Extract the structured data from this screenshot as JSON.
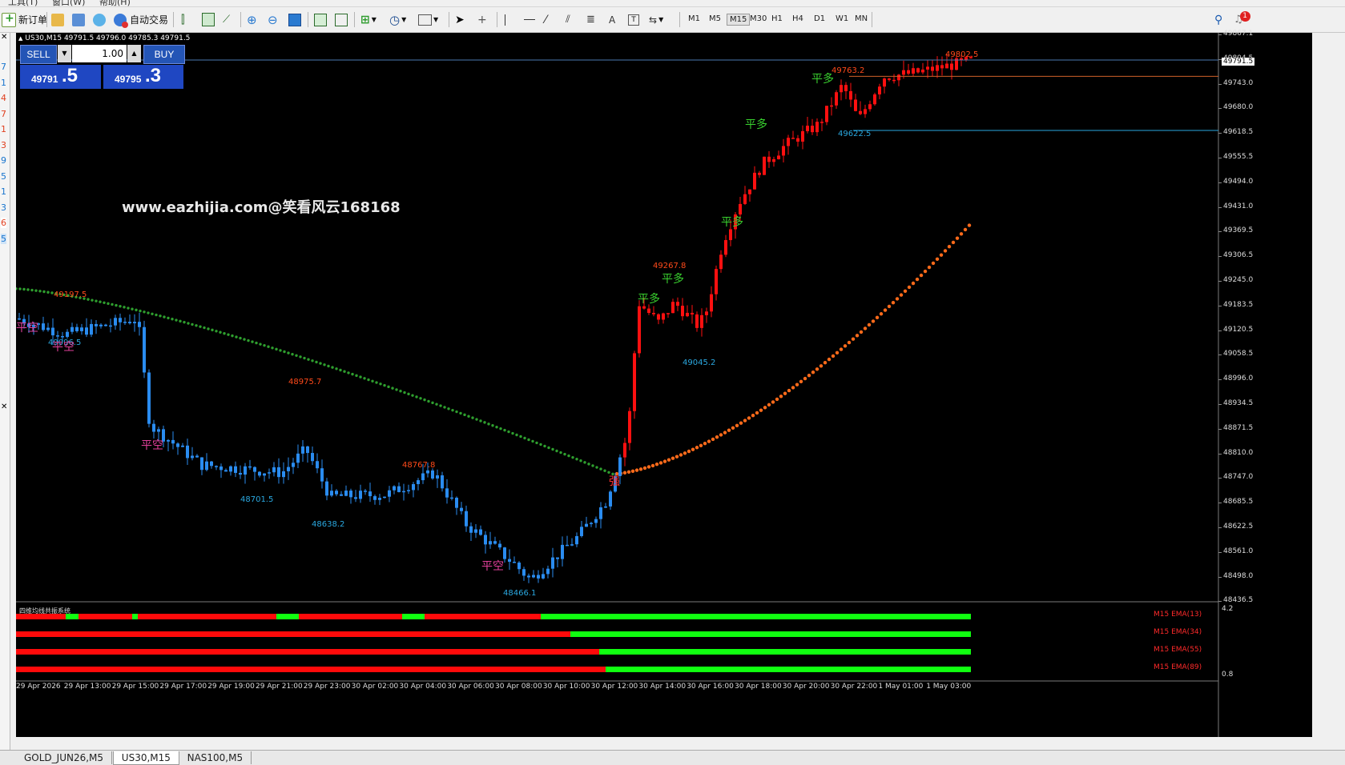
{
  "menu": {
    "tools": "工具(T)",
    "window": "窗口(W)",
    "help": "帮助(H)"
  },
  "toolbar": {
    "new_order": "新订单",
    "auto_trade": "自动交易",
    "timeframes": [
      "M1",
      "M5",
      "M15",
      "M30",
      "H1",
      "H4",
      "D1",
      "W1",
      "MN"
    ],
    "active_timeframe": "M15",
    "alert_count": "1"
  },
  "left_strip_digits": [
    "7",
    "1",
    "4",
    "7",
    "1",
    "3",
    "9",
    "5",
    "1",
    "3",
    "6",
    "5"
  ],
  "chart": {
    "header": "US30,M15  49791.5 49796.0 49785.3 49791.5",
    "watermark": "www.eazhijia.com@笑看风云168168",
    "trade": {
      "sell_label": "SELL",
      "buy_label": "BUY",
      "volume": "1.00",
      "sell_big": "49791",
      "sell_small": ".5",
      "buy_big": "49795",
      "buy_small": ".3"
    },
    "price_axis": [
      "49867.1",
      "49804.5",
      "49743.0",
      "49680.0",
      "49618.5",
      "49555.5",
      "49494.0",
      "49431.0",
      "49369.5",
      "49306.5",
      "49245.0",
      "49183.5",
      "49120.5",
      "49058.5",
      "48996.0",
      "48934.5",
      "48871.5",
      "48810.0",
      "48747.0",
      "48685.5",
      "48622.5",
      "48561.0",
      "48498.0",
      "48436.5"
    ],
    "current_price_tag": "49791.5",
    "time_axis": [
      "29 Apr 2026",
      "29 Apr 13:00",
      "29 Apr 15:00",
      "29 Apr 17:00",
      "29 Apr 19:00",
      "29 Apr 21:00",
      "29 Apr 23:00",
      "30 Apr 02:00",
      "30 Apr 04:00",
      "30 Apr 06:00",
      "30 Apr 08:00",
      "30 Apr 10:00",
      "30 Apr 12:00",
      "30 Apr 14:00",
      "30 Apr 16:00",
      "30 Apr 18:00",
      "30 Apr 20:00",
      "30 Apr 22:00",
      "1 May 01:00",
      "1 May 03:00"
    ],
    "price_labels": [
      {
        "text": "49197.5",
        "kind": "high"
      },
      {
        "text": "49096.5",
        "kind": "low"
      },
      {
        "text": "48975.7",
        "kind": "high"
      },
      {
        "text": "48701.5",
        "kind": "low"
      },
      {
        "text": "48638.2",
        "kind": "low"
      },
      {
        "text": "48767.8",
        "kind": "high"
      },
      {
        "text": "48466.1",
        "kind": "low"
      },
      {
        "text": "49267.8",
        "kind": "high"
      },
      {
        "text": "49045.2",
        "kind": "low"
      },
      {
        "text": "49763.2",
        "kind": "high"
      },
      {
        "text": "49622.5",
        "kind": "low"
      },
      {
        "text": "49802.5",
        "kind": "high"
      }
    ],
    "signals": [
      {
        "text": "平空",
        "color": "#e0409a"
      },
      {
        "text": "平空",
        "color": "#e0409a"
      },
      {
        "text": "平空",
        "color": "#e0409a"
      },
      {
        "text": "平空",
        "color": "#e0409a"
      },
      {
        "text": "强",
        "color": "#ff3030"
      },
      {
        "text": "平多",
        "color": "#39d12f"
      },
      {
        "text": "平多",
        "color": "#39d12f"
      },
      {
        "text": "平多",
        "color": "#39d12f"
      },
      {
        "text": "平多",
        "color": "#39d12f"
      },
      {
        "text": "平多",
        "color": "#39d12f"
      }
    ],
    "indicator_title": "四维均线共振系统",
    "indicator_scale": [
      "4.2",
      "0.8"
    ],
    "ema_labels": [
      "M15 EMA(13)",
      "M15 EMA(34)",
      "M15 EMA(55)",
      "M15 EMA(89)"
    ]
  },
  "tabs": [
    "GOLD_JUN26,M5",
    "US30,M15",
    "NAS100,M5"
  ],
  "active_tab": "US30,M15"
}
